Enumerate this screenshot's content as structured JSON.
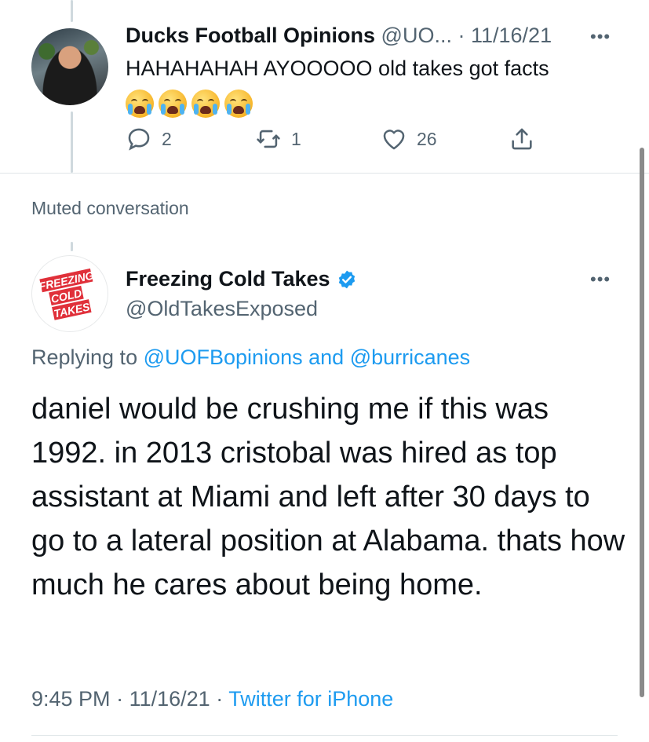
{
  "tweet1": {
    "display_name": "Ducks Football Opinions",
    "handle": "@UO...",
    "separator": "·",
    "date": "11/16/21",
    "text": "HAHAHAHAH AYOOOOO old takes got facts",
    "emojis": [
      "loudly-crying-face",
      "loudly-crying-face",
      "loudly-crying-face",
      "loudly-crying-face"
    ],
    "more": "•••",
    "actions": {
      "replies": "2",
      "retweets": "1",
      "likes": "26"
    }
  },
  "muted_label": "Muted conversation",
  "tweet2": {
    "logo_lines": [
      "FREEZING",
      "COLD",
      "TAKES"
    ],
    "display_name": "Freezing Cold Takes",
    "handle": "@OldTakesExposed",
    "more": "•••",
    "replying_prefix": "Replying to",
    "replying_user1": "@UOFBopinions",
    "replying_and": "and",
    "replying_user2": "@burricanes",
    "text": "daniel would be crushing me if this was 1992. in 2013 cristobal was hired as top assistant at Miami and left after 30 days to go to a lateral position at Alabama. thats how much he cares about being home.",
    "time": "9:45 PM",
    "separator": "·",
    "date": "11/16/21",
    "source": "Twitter for iPhone"
  },
  "colors": {
    "accent": "#1d9bf0",
    "secondary_text": "#536471",
    "verified": "#1d9bf0",
    "logo_red": "#e0303a"
  }
}
